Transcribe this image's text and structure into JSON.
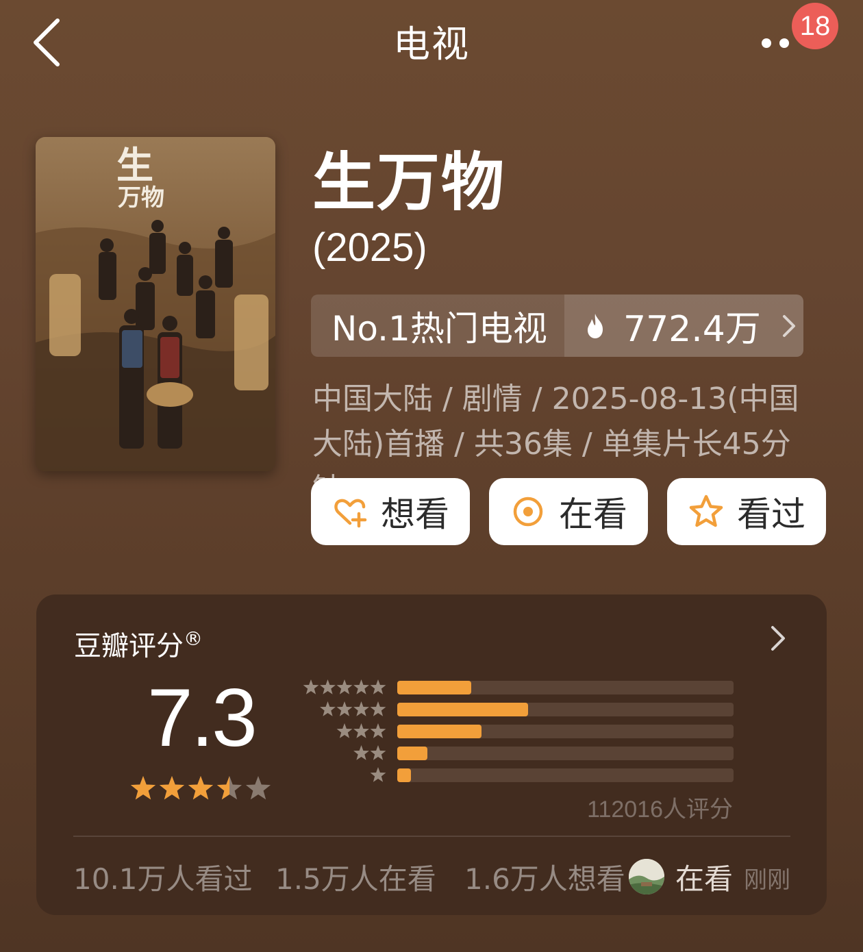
{
  "header": {
    "title": "电视",
    "notification_count": "18",
    "icons": [
      "chevron-left-icon",
      "more-icon"
    ]
  },
  "show": {
    "title": "生万物",
    "year": "(2025)",
    "rank_label": "No.1热门电视",
    "heat_value": "772.4万",
    "meta_text": "中国大陆 / 剧情 / 2025-08-13(中国大陆)首播 / 共36集 / 单集片长45分钟",
    "poster_description": "poster"
  },
  "actions": [
    {
      "label": "想看",
      "icon": "heart-plus-icon"
    },
    {
      "label": "在看",
      "icon": "target-icon"
    },
    {
      "label": "看过",
      "icon": "star-outline-icon"
    }
  ],
  "rating": {
    "title": "豆瓣评分",
    "trademark": "®",
    "score": "7.3",
    "star_value": 3.5,
    "distribution": [
      {
        "stars": 5,
        "fraction": 0.22
      },
      {
        "stars": 4,
        "fraction": 0.39
      },
      {
        "stars": 3,
        "fraction": 0.25
      },
      {
        "stars": 2,
        "fraction": 0.09
      },
      {
        "stars": 1,
        "fraction": 0.04
      }
    ],
    "votes_text": "112016人评分"
  },
  "stats": {
    "watched": "10.1万人看过",
    "watching": "1.5万人在看",
    "want": "1.6万人想看",
    "friend_status": "在看",
    "friend_time": "刚刚"
  },
  "colors": {
    "accent_orange": "#f29f3a",
    "badge_red": "#ec5e58",
    "background": "#654530",
    "card": "#422c1f"
  }
}
